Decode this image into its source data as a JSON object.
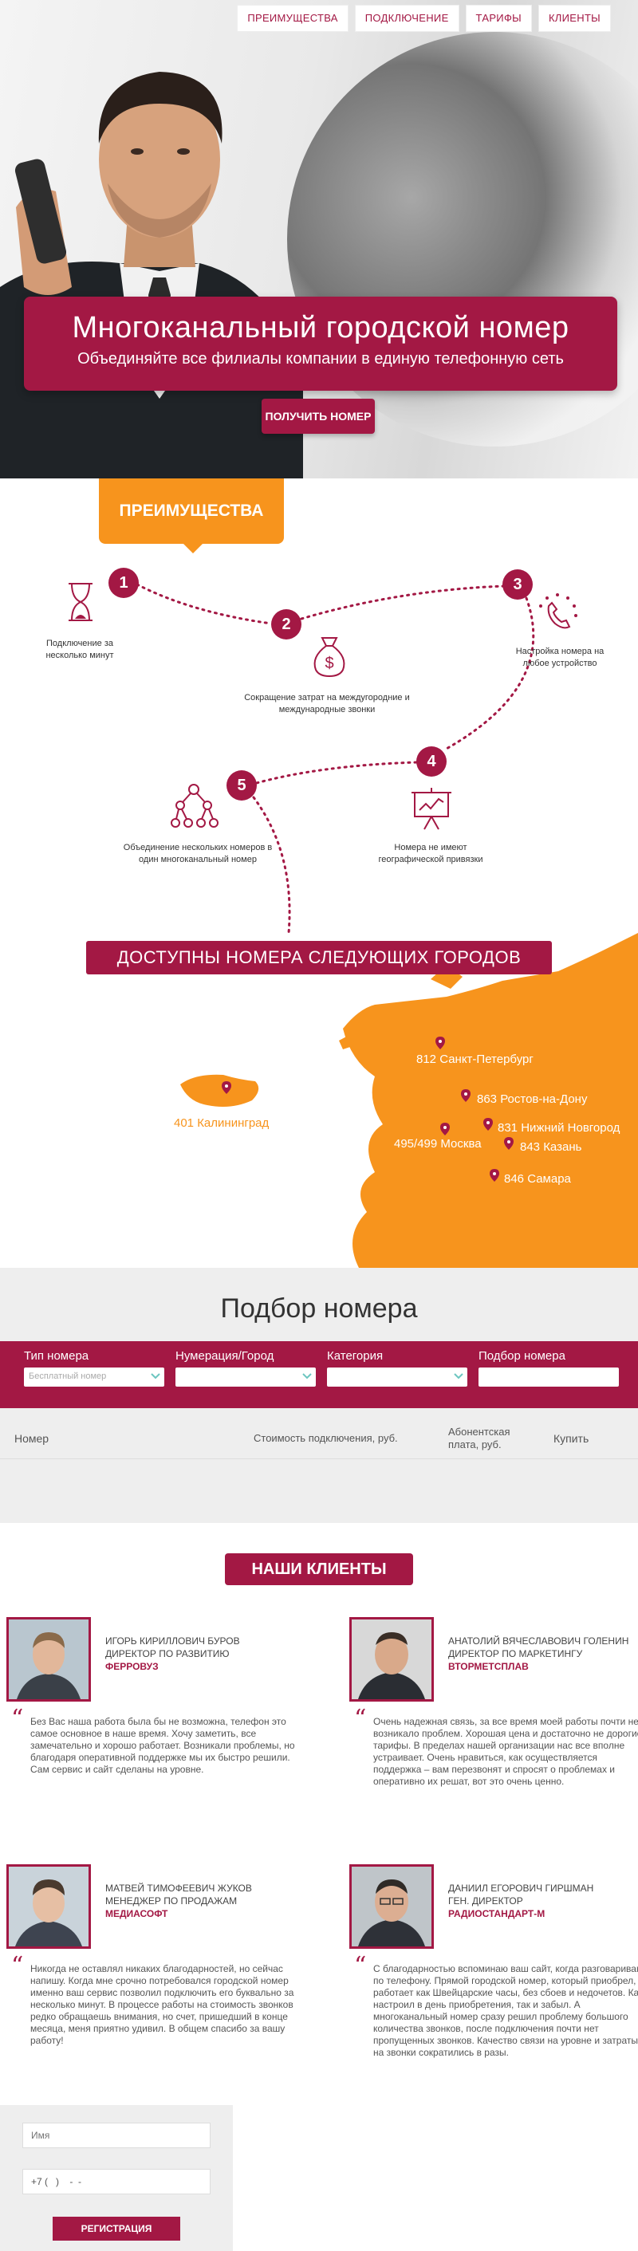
{
  "nav": {
    "items": [
      "ПРЕИМУЩЕСТВА",
      "ПОДКЛЮЧЕНИЕ",
      "ТАРИФЫ",
      "КЛИЕНТЫ"
    ]
  },
  "hero": {
    "title": "Многоканальный городской номер",
    "subtitle": "Объединяйте все филиалы компании в единую телефонную сеть",
    "cta": "ПОЛУЧИТЬ НОМЕР"
  },
  "advantages": {
    "title": "ПРЕИМУЩЕСТВА",
    "items": [
      {
        "num": "1",
        "text": "Подключение за несколько минут",
        "icon": "hourglass-icon"
      },
      {
        "num": "2",
        "text": "Сокращение затрат на междугородние и международные звонки",
        "icon": "money-bag-icon"
      },
      {
        "num": "3",
        "text": "Настройка номера на любое устройство",
        "icon": "phone-ring-icon"
      },
      {
        "num": "4",
        "text": "Номера не имеют географической привязки",
        "icon": "presentation-icon"
      },
      {
        "num": "5",
        "text": "Объединение нескольких номеров в один многоканальный номер",
        "icon": "network-icon"
      }
    ]
  },
  "cities": {
    "heading": "ДОСТУПНЫ НОМЕРА СЛЕДУЮЩИХ ГОРОДОВ",
    "list": [
      "812 Санкт-Петербург",
      "863 Ростов-на-Дону",
      "831 Нижний Новгород",
      "495/499 Москва",
      "843 Казань",
      "846 Самара",
      "401 Калининград"
    ]
  },
  "picker": {
    "title": "Подбор номера",
    "fields": [
      {
        "label": "Тип номера",
        "value": "Бесплатный номер"
      },
      {
        "label": "Нумерация/Город",
        "value": ""
      },
      {
        "label": "Категория",
        "value": ""
      },
      {
        "label": "Подбор номера",
        "value": ""
      }
    ],
    "columns": [
      "Номер",
      "Стоимость подключения, руб.",
      "Абонентская плата, руб.",
      "Купить"
    ]
  },
  "clients": {
    "title": "НАШИ КЛИЕНТЫ",
    "list": [
      {
        "name": "ИГОРЬ КИРИЛЛОВИЧ БУРОВ",
        "role": "ДИРЕКТОР ПО РАЗВИТИЮ",
        "company": "ФЕРРОВУЗ",
        "quote": "Без Вас наша работа была бы не возможна, телефон это самое основное в наше время. Хочу заметить, все замечательно и хорошо работает. Возникали проблемы, но благодаря оперативной поддержке мы их быстро решили. Сам сервис и сайт сделаны на уровне."
      },
      {
        "name": "АНАТОЛИЙ ВЯЧЕСЛАВОВИЧ ГОЛЕНИН",
        "role": "ДИРЕКТОР ПО МАРКЕТИНГУ",
        "company": "ВТОРМЕТСПЛАВ",
        "quote": "Очень надежная связь, за все время моей работы почти не возникало проблем. Хорошая цена и достаточно не дорогие тарифы. В пределах нашей организации нас все вполне устраивает. Очень нравиться, как осуществляется поддержка – вам перезвонят и спросят о проблемах и оперативно их решат, вот это очень ценно."
      },
      {
        "name": "МАТВЕЙ ТИМОФЕЕВИЧ ЖУКОВ",
        "role": "МЕНЕДЖЕР ПО ПРОДАЖАМ",
        "company": "МЕДИАСОФТ",
        "quote": "Никогда не оставлял никаких благодарностей, но сейчас напишу. Когда мне срочно потребовался городской номер именно ваш сервис позволил подключить его буквально за несколько минут. В процессе работы на стоимость звонков редко обращаешь внимания, но счет, пришедший в конце месяца, меня приятно удивил. В общем спасибо за вашу работу!"
      },
      {
        "name": "ДАНИИЛ ЕГОРОВИЧ ГИРШМАН",
        "role": "ГЕН. ДИРЕКТОР",
        "company": "РАДИОСТАНДАРТ-М",
        "quote": "С благодарностью вспоминаю ваш сайт, когда разговариваю по телефону. Прямой городской номер, который приобрел, работает как Швейцарские часы, без сбоев и недочетов. Как настроил в день приобретения, так и забыл. А многоканальный номер сразу решил проблему большого количества звонков, после подключения почти нет пропущенных звонков. Качество связи на уровне и затраты на звонки сократились в разы."
      }
    ]
  },
  "form": {
    "name_placeholder": "Имя",
    "phone_value": "+7 (   )    -  -",
    "submit": "РЕГИСТРАЦИЯ"
  },
  "colors": {
    "brand": "#a31844",
    "accent": "#f7941d"
  }
}
